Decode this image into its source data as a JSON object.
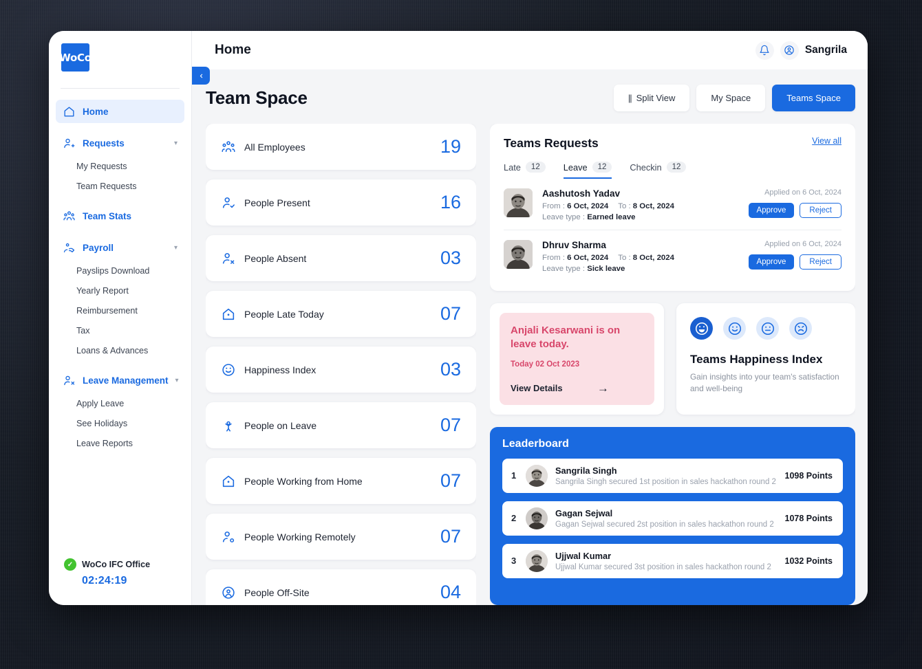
{
  "sidebar": {
    "logo_text": "WoCo",
    "groups": [
      {
        "label": "Home",
        "icon": "home-icon",
        "active": true,
        "expandable": false,
        "children": []
      },
      {
        "label": "Requests",
        "icon": "person-add-icon",
        "active": false,
        "expandable": true,
        "children": [
          "My Requests",
          "Team Requests"
        ]
      },
      {
        "label": "Team Stats",
        "icon": "people-icon",
        "active": false,
        "expandable": false,
        "children": []
      },
      {
        "label": "Payroll",
        "icon": "payroll-hand-icon",
        "active": false,
        "expandable": true,
        "children": [
          "Payslips Download",
          "Yearly Report",
          "Reimbursement",
          "Tax",
          "Loans & Advances"
        ]
      },
      {
        "label": "Leave Management",
        "icon": "person-remove-icon",
        "active": false,
        "expandable": true,
        "children": [
          "Apply Leave",
          "See Holidays",
          "Leave Reports"
        ]
      }
    ],
    "footer": {
      "office_name": "WoCo IFC Office",
      "timer": "02:24:19",
      "status_color": "#43c330"
    }
  },
  "topbar": {
    "title": "Home",
    "username": "Sangrila",
    "bell_icon": "bell-icon",
    "avatar_icon": "user-circle-icon",
    "collapse_icon": "chevron-left-icon"
  },
  "page": {
    "title": "Team Space",
    "buttons": [
      {
        "label": "Split View",
        "icon": "split-view-bars",
        "primary": false
      },
      {
        "label": "My Space",
        "icon": "",
        "primary": false
      },
      {
        "label": "Teams Space",
        "icon": "",
        "primary": true
      }
    ]
  },
  "stats": [
    {
      "label": "All Employees",
      "value": "19",
      "icon": "group-people-icon"
    },
    {
      "label": "People Present",
      "value": "16",
      "icon": "person-check-icon"
    },
    {
      "label": "People Absent",
      "value": "03",
      "icon": "person-x-icon"
    },
    {
      "label": "People Late Today",
      "value": "07",
      "icon": "home-dot-icon"
    },
    {
      "label": "Happiness Index",
      "value": "03",
      "icon": "smiley-icon"
    },
    {
      "label": "People on Leave",
      "value": "07",
      "icon": "person-raised-hand-icon"
    },
    {
      "label": "People Working from Home",
      "value": "07",
      "icon": "home-dot-icon"
    },
    {
      "label": "People Working Remotely",
      "value": "07",
      "icon": "person-remote-icon"
    },
    {
      "label": "People Off-Site",
      "value": "04",
      "icon": "person-badge-icon"
    }
  ],
  "requests_panel": {
    "title": "Teams  Requests",
    "view_all": "View all",
    "tabs": [
      {
        "label": "Late",
        "count": "12",
        "active": false
      },
      {
        "label": "Leave",
        "count": "12",
        "active": true
      },
      {
        "label": "Checkin",
        "count": "12",
        "active": false
      }
    ],
    "from_label": "From :",
    "to_label": "To :",
    "leave_type_label": "Leave type :",
    "approve_label": "Approve",
    "reject_label": "Reject",
    "rows": [
      {
        "name": "Aashutosh Yadav",
        "from": "6 Oct, 2024",
        "to": "8 Oct, 2024",
        "leave_type": "Earned leave",
        "applied": "Applied on 6 Oct, 2024"
      },
      {
        "name": "Dhruv Sharma",
        "from": "6 Oct, 2024",
        "to": "8 Oct, 2024",
        "leave_type": "Sick leave",
        "applied": "Applied on 6 Oct, 2024"
      }
    ]
  },
  "leave_notice": {
    "headline": "Anjali Kesarwani is on leave today.",
    "date": "Today 02 Oct 2023",
    "link": "View Details",
    "accent": "#d8476b",
    "background": "#fbe0e5"
  },
  "happiness": {
    "title": "Teams Happiness Index",
    "subtitle": "Gain insights into your team's satisfaction and well-being",
    "faces": [
      {
        "name": "laughing-face-icon",
        "selected": true
      },
      {
        "name": "smiling-face-icon",
        "selected": false
      },
      {
        "name": "neutral-face-icon",
        "selected": false
      },
      {
        "name": "sad-face-icon",
        "selected": false
      }
    ]
  },
  "leaderboard": {
    "title": "Leaderboard",
    "rows": [
      {
        "rank": "1",
        "name": "Sangrila Singh",
        "desc": "Sangrila Singh secured 1st  position in sales hackathon round 2",
        "points": "1098 Points"
      },
      {
        "rank": "2",
        "name": "Gagan Sejwal",
        "desc": "Gagan Sejwal secured 2st  position in sales hackathon round 2",
        "points": "1078 Points"
      },
      {
        "rank": "3",
        "name": "Ujjwal Kumar",
        "desc": "Ujjwal Kumar secured 3st  position in sales hackathon round 2",
        "points": "1032 Points"
      }
    ]
  },
  "colors": {
    "accent": "#1a6ae0",
    "bg": "#f4f5f7",
    "danger": "#d8476b",
    "success": "#43c330"
  }
}
